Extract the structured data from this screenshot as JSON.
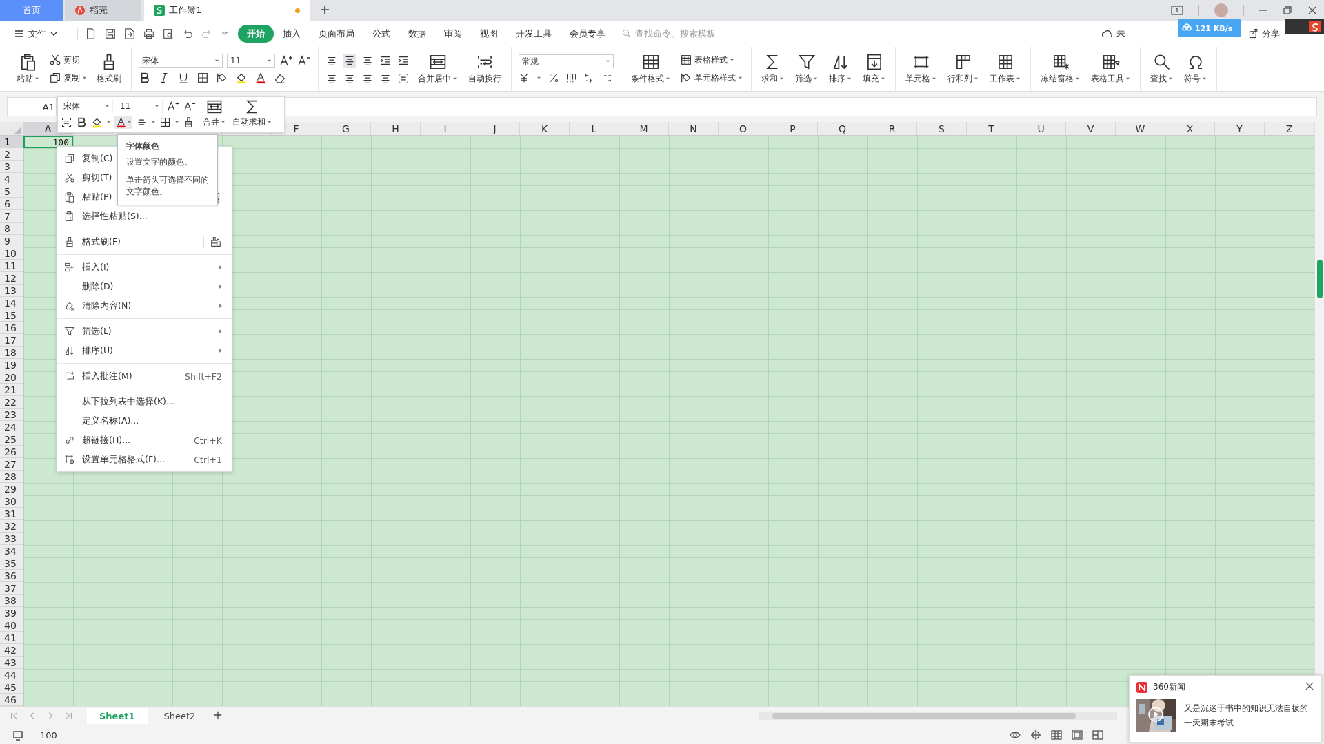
{
  "tabs": [
    {
      "label": "首页",
      "kind": "home",
      "selected": false
    },
    {
      "label": "稻壳",
      "kind": "docer",
      "selected": false
    },
    {
      "label": "工作簿1",
      "kind": "sheet",
      "selected": true,
      "unsaved": true
    }
  ],
  "menubar": {
    "file": "文件",
    "tabs": [
      {
        "label": "开始",
        "selected": true
      },
      {
        "label": "插入",
        "selected": false
      },
      {
        "label": "页面布局",
        "selected": false
      },
      {
        "label": "公式",
        "selected": false
      },
      {
        "label": "数据",
        "selected": false
      },
      {
        "label": "审阅",
        "selected": false
      },
      {
        "label": "视图",
        "selected": false
      },
      {
        "label": "开发工具",
        "selected": false
      },
      {
        "label": "会员专享",
        "selected": false
      }
    ],
    "search": {
      "placeholder": "查找命令、搜索模板"
    },
    "cloud": "未",
    "share": "分享"
  },
  "download_badge": "121 KB/s",
  "ribbon": {
    "paste": "粘贴",
    "cut": "剪切",
    "copy": "复制",
    "format_painter": "格式刷",
    "font": "宋体",
    "size": "11",
    "merge": "合并居中",
    "wrap": "自动换行",
    "number_format": "常规",
    "conditional": "条件格式",
    "table_style": "表格样式",
    "cell_style": "单元格样式",
    "tools": [
      "求和",
      "筛选",
      "排序",
      "填充",
      "单元格",
      "行和列",
      "工作表",
      "冻结窗格",
      "表格工具",
      "查找",
      "符号"
    ]
  },
  "name_box": "A1",
  "mini_toolbar": {
    "font": "宋体",
    "size": "11",
    "merge": "合并",
    "autosum": "自动求和"
  },
  "tooltip": {
    "title": "字体颜色",
    "lines": [
      "设置文字的颜色。",
      "单击箭头可选择不同的文字颜色。"
    ]
  },
  "grid": {
    "columns": [
      {
        "label": "A",
        "selected": true
      },
      {
        "selected": false
      },
      {
        "selected": false
      },
      {
        "selected": false
      },
      {
        "selected": false
      },
      {
        "label": "F",
        "selected": false
      },
      {
        "label": "G",
        "selected": false
      },
      {
        "label": "H",
        "selected": false
      },
      {
        "label": "I",
        "selected": false
      },
      {
        "label": "J",
        "selected": false
      },
      {
        "label": "K",
        "selected": false
      },
      {
        "label": "L",
        "selected": false
      },
      {
        "label": "M",
        "selected": false
      },
      {
        "label": "N",
        "selected": false
      },
      {
        "label": "O",
        "selected": false
      },
      {
        "label": "P",
        "selected": false
      },
      {
        "label": "Q",
        "selected": false
      },
      {
        "label": "R",
        "selected": false
      },
      {
        "label": "S",
        "selected": false
      },
      {
        "label": "T",
        "selected": false
      },
      {
        "label": "U",
        "selected": false
      },
      {
        "label": "V",
        "selected": false
      },
      {
        "label": "W",
        "selected": false
      },
      {
        "label": "X",
        "selected": false
      },
      {
        "label": "Y",
        "selected": false
      },
      {
        "label": "Z",
        "selected": false
      }
    ],
    "rows": [
      {
        "label": "1",
        "selected": true
      },
      {
        "label": "2",
        "selected": false
      },
      {
        "label": "3",
        "selected": false
      },
      {
        "label": "4",
        "selected": false
      },
      {
        "label": "5",
        "selected": false
      },
      {
        "label": "6",
        "selected": false
      },
      {
        "label": "7",
        "selected": false
      },
      {
        "label": "8",
        "selected": false
      },
      {
        "label": "9",
        "selected": false
      },
      {
        "label": "10",
        "selected": false
      },
      {
        "label": "11",
        "selected": false
      },
      {
        "label": "12",
        "selected": false
      },
      {
        "label": "13",
        "selected": false
      },
      {
        "label": "14",
        "selected": false
      },
      {
        "label": "15",
        "selected": false
      },
      {
        "label": "16",
        "selected": false
      },
      {
        "label": "17",
        "selected": false
      },
      {
        "label": "18",
        "selected": false
      },
      {
        "label": "19",
        "selected": false
      },
      {
        "label": "20",
        "selected": false
      },
      {
        "label": "21",
        "selected": false
      },
      {
        "label": "22",
        "selected": false
      },
      {
        "label": "23",
        "selected": false
      },
      {
        "label": "24",
        "selected": false
      },
      {
        "label": "25",
        "selected": false
      },
      {
        "label": "26",
        "selected": false
      },
      {
        "label": "27",
        "selected": false
      },
      {
        "label": "28",
        "selected": false
      },
      {
        "label": "29",
        "selected": false
      },
      {
        "label": "30",
        "selected": false
      },
      {
        "label": "31",
        "selected": false
      },
      {
        "label": "32",
        "selected": false
      },
      {
        "label": "33",
        "selected": false
      },
      {
        "label": "34",
        "selected": false
      },
      {
        "label": "35",
        "selected": false
      },
      {
        "label": "36",
        "selected": false
      },
      {
        "label": "37",
        "selected": false
      },
      {
        "label": "38",
        "selected": false
      },
      {
        "label": "39",
        "selected": false
      },
      {
        "label": "40",
        "selected": false
      },
      {
        "label": "41",
        "selected": false
      },
      {
        "label": "42",
        "selected": false
      },
      {
        "label": "43",
        "selected": false
      },
      {
        "label": "44",
        "selected": false
      },
      {
        "label": "45",
        "selected": false
      },
      {
        "label": "46",
        "selected": false
      }
    ],
    "cells": [
      {
        "value": "100",
        "active": true
      }
    ]
  },
  "context_menu": [
    {
      "kind": "item",
      "label": "复制(C)"
    },
    {
      "kind": "item",
      "label": "剪切(T)"
    },
    {
      "kind": "item",
      "label": "粘贴(P)"
    },
    {
      "kind": "item",
      "label": "选择性粘贴(S)..."
    },
    {
      "kind": "separator"
    },
    {
      "kind": "item",
      "label": "格式刷(F)"
    },
    {
      "kind": "separator"
    },
    {
      "kind": "item",
      "label": "插入(I)",
      "submenu": true
    },
    {
      "kind": "item",
      "label": "删除(D)",
      "submenu": true
    },
    {
      "kind": "item",
      "label": "清除内容(N)",
      "submenu": true
    },
    {
      "kind": "separator"
    },
    {
      "kind": "item",
      "label": "筛选(L)",
      "submenu": true
    },
    {
      "kind": "item",
      "label": "排序(U)",
      "submenu": true
    },
    {
      "kind": "separator"
    },
    {
      "kind": "item",
      "label": "插入批注(M)",
      "shortcut": "Shift+F2"
    },
    {
      "kind": "separator"
    },
    {
      "kind": "item",
      "label": "从下拉列表中选择(K)..."
    },
    {
      "kind": "item",
      "label": "定义名称(A)..."
    },
    {
      "kind": "item",
      "label": "超链接(H)...",
      "shortcut": "Ctrl+K"
    },
    {
      "kind": "item",
      "label": "设置单元格格式(F)...",
      "shortcut": "Ctrl+1"
    }
  ],
  "sheets": [
    {
      "label": "Sheet1",
      "selected": true
    },
    {
      "label": "Sheet2",
      "selected": false
    }
  ],
  "status": {
    "value": "100"
  },
  "news": {
    "source": "360新闻",
    "lines": [
      "又是沉迷于书中的知识无法自拔的",
      "一天期末考试"
    ]
  }
}
